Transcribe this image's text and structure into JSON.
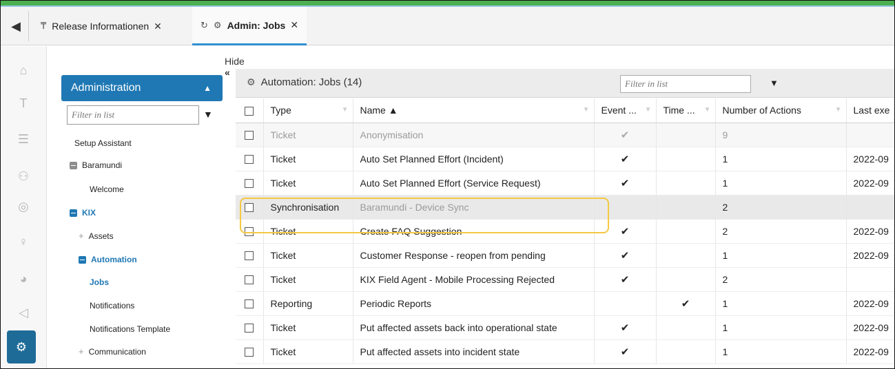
{
  "tabs": [
    {
      "icon": "pin-icon",
      "label": "Release Informationen"
    },
    {
      "icon": "gears-icon",
      "label": "Admin: Jobs"
    }
  ],
  "sidebar": {
    "hide_label": "Hide",
    "header": "Administration",
    "filter_placeholder": "Filter in list",
    "items": [
      {
        "label": "Setup Assistant"
      },
      {
        "label": "Baramundi"
      },
      {
        "label": "Welcome"
      },
      {
        "label": "KIX"
      },
      {
        "label": "Assets"
      },
      {
        "label": "Automation"
      },
      {
        "label": "Jobs"
      },
      {
        "label": "Notifications"
      },
      {
        "label": "Notifications Template"
      },
      {
        "label": "Communication"
      }
    ]
  },
  "panel": {
    "title": "Automation: Jobs (14)",
    "filter_placeholder": "Filter in list"
  },
  "table": {
    "columns": [
      "Type",
      "Name ▲",
      "Event ...",
      "Time ...",
      "Number of Actions",
      "Last exe"
    ],
    "rows": [
      {
        "type": "Ticket",
        "name": "Anonymisation",
        "event": "✔",
        "time": "",
        "actions": "9",
        "last": ""
      },
      {
        "type": "Ticket",
        "name": "Auto Set Planned Effort (Incident)",
        "event": "✔",
        "time": "",
        "actions": "1",
        "last": "2022-09"
      },
      {
        "type": "Ticket",
        "name": "Auto Set Planned Effort (Service Request)",
        "event": "✔",
        "time": "",
        "actions": "1",
        "last": "2022-09"
      },
      {
        "type": "Synchronisation",
        "name": "Baramundi - Device Sync",
        "event": "",
        "time": "",
        "actions": "2",
        "last": ""
      },
      {
        "type": "Ticket",
        "name": "Create FAQ Suggestion",
        "event": "✔",
        "time": "",
        "actions": "2",
        "last": "2022-09"
      },
      {
        "type": "Ticket",
        "name": "Customer Response - reopen from pending",
        "event": "✔",
        "time": "",
        "actions": "1",
        "last": "2022-09"
      },
      {
        "type": "Ticket",
        "name": "KIX Field Agent - Mobile Processing Rejected",
        "event": "✔",
        "time": "",
        "actions": "2",
        "last": ""
      },
      {
        "type": "Reporting",
        "name": "Periodic Reports",
        "event": "",
        "time": "✔",
        "actions": "1",
        "last": "2022-09"
      },
      {
        "type": "Ticket",
        "name": "Put affected assets back into operational state",
        "event": "✔",
        "time": "",
        "actions": "1",
        "last": "2022-09"
      },
      {
        "type": "Ticket",
        "name": "Put affected assets into incident state",
        "event": "✔",
        "time": "",
        "actions": "1",
        "last": "2022-09"
      }
    ]
  },
  "colors": {
    "accent": "#1f78b4",
    "highlight": "#f5c842",
    "top_bar": "#4caf50"
  }
}
